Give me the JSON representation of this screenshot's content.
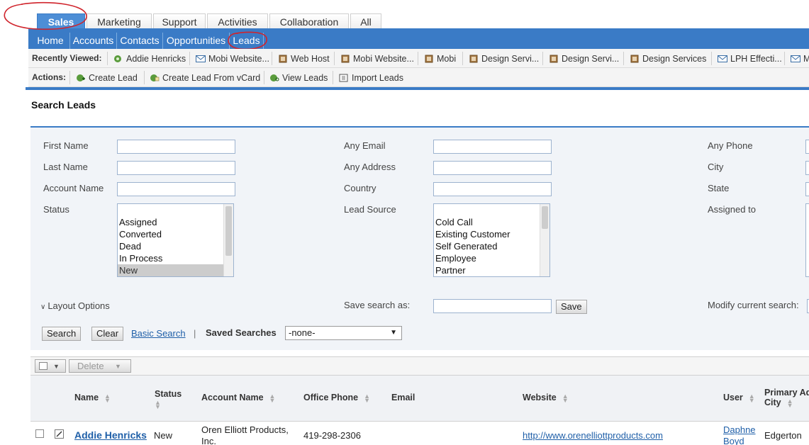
{
  "module_tabs": [
    "Sales",
    "Marketing",
    "Support",
    "Activities",
    "Collaboration",
    "All"
  ],
  "sub_tabs": [
    "Home",
    "Accounts",
    "Contacts",
    "Opportunities",
    "Leads"
  ],
  "recently_viewed": {
    "label": "Recently Viewed:",
    "items": [
      "Addie Henricks",
      "Mobi Website...",
      "Web Host",
      "Mobi Website...",
      "Mobi",
      "Design Servi...",
      "Design Servi...",
      "Design Services",
      "LPH Effecti...",
      "M"
    ]
  },
  "actions": {
    "label": "Actions:",
    "items": [
      "Create Lead",
      "Create Lead From vCard",
      "View Leads",
      "Import Leads"
    ]
  },
  "page_title": "Search Leads",
  "search_form": {
    "labels": {
      "first_name": "First Name",
      "last_name": "Last Name",
      "account_name": "Account Name",
      "status": "Status",
      "any_email": "Any Email",
      "any_address": "Any Address",
      "country": "Country",
      "lead_source": "Lead Source",
      "any_phone": "Any Phone",
      "city": "City",
      "state": "State",
      "assigned_to": "Assigned to"
    },
    "status_options": [
      "Assigned",
      "Converted",
      "Dead",
      "In Process",
      "New"
    ],
    "lead_source_options": [
      "Cold Call",
      "Existing Customer",
      "Self Generated",
      "Employee",
      "Partner"
    ],
    "layout_options": "Layout Options",
    "save_search_as": "Save search as:",
    "save_button": "Save",
    "modify_current_search": "Modify current search:",
    "search_button": "Search",
    "clear_button": "Clear",
    "basic_search": "Basic Search",
    "pipe": "|",
    "saved_searches_label": "Saved Searches",
    "saved_searches_value": "-none-"
  },
  "results": {
    "delete_button": "Delete",
    "columns": {
      "name": "Name",
      "status": "Status",
      "account_name": "Account Name",
      "office_phone": "Office Phone",
      "email": "Email",
      "website": "Website",
      "user": "User",
      "primary_address": "Primary Ad",
      "city": "City"
    },
    "rows": [
      {
        "name": "Addie Henricks",
        "status": "New",
        "account_name": "Oren Elliott Products, Inc.",
        "office_phone": "419-298-2306",
        "email": "",
        "website": "http://www.orenelliottproducts.com",
        "user": "Daphne Boyd",
        "city": "Edgerton"
      }
    ]
  },
  "colors": {
    "accent": "#3a7bc6",
    "active_tab": "#4d8ed6",
    "annotation": "#d0242c",
    "link": "#1f5fa8"
  }
}
